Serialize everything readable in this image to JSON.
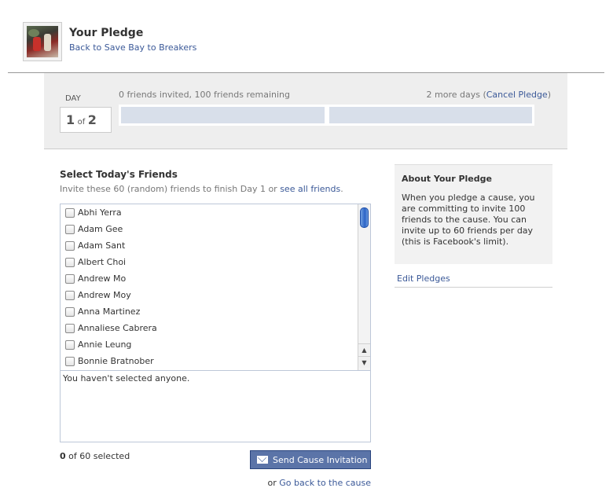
{
  "header": {
    "title": "Your Pledge",
    "back_link": "Back to Save Bay to Breakers"
  },
  "progress": {
    "day_label": "DAY",
    "day_current": "1",
    "day_of": "of",
    "day_total": "2",
    "invite_status": "0 friends invited, 100 friends remaining",
    "days_left_text": "2 more days (",
    "cancel_link": "Cancel Pledge",
    "days_left_close": ")",
    "day_fill_fractions": [
      0,
      0
    ]
  },
  "select": {
    "title": "Select Today's Friends",
    "subtitle": "Invite these 60 (random) friends to finish Day 1 or ",
    "see_all_link": "see all friends",
    "subtitle_end": ".",
    "friends": [
      "Abhi Yerra",
      "Adam Gee",
      "Adam Sant",
      "Albert Choi",
      "Andrew Mo",
      "Andrew Moy",
      "Anna Martinez",
      "Annaliese Cabrera",
      "Annie Leung",
      "Bonnie Bratnober"
    ],
    "selected_placeholder": "You haven't selected anyone.",
    "selected_count": "0",
    "selected_of": " of 60 selected",
    "send_button": "Send Cause Invitation",
    "go_back_prefix": "or ",
    "go_back_link": "Go back to the cause"
  },
  "about": {
    "title": "About Your Pledge",
    "text": "When you pledge a cause, you are committing to invite 100 friends to the cause. You can invite up to 60 friends per day (this is Facebook's limit).",
    "edit_link": "Edit Pledges"
  },
  "colors": {
    "link": "#3b5998",
    "button": "#5b74a8",
    "bar_empty": "#d8dfea"
  }
}
